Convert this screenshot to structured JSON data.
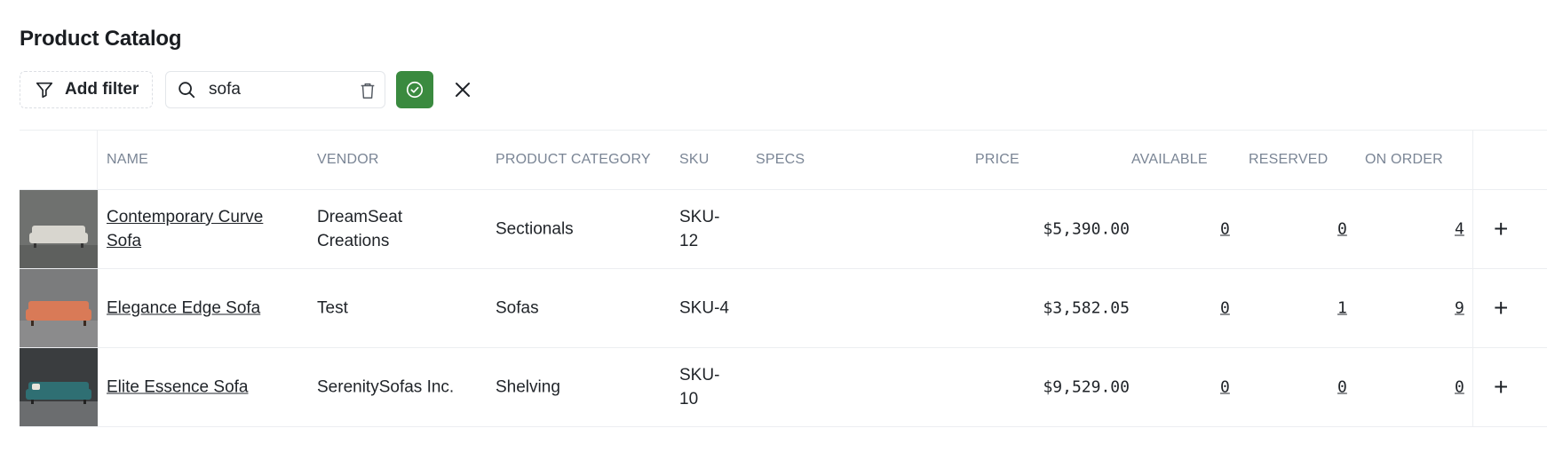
{
  "page": {
    "title": "Product Catalog"
  },
  "toolbar": {
    "add_filter_label": "Add filter",
    "search_value": "sofa",
    "apply_color": "#3a8a3f"
  },
  "table": {
    "headers": {
      "name": "NAME",
      "vendor": "VENDOR",
      "category": "PRODUCT CATEGORY",
      "sku": "SKU",
      "specs": "SPECS",
      "price": "PRICE",
      "available": "AVAILABLE",
      "reserved": "RESERVED",
      "on_order": "ON ORDER"
    },
    "rows": [
      {
        "name": "Contemporary Curve Sofa",
        "vendor": "DreamSeat Creations",
        "category": "Sectionals",
        "sku": "SKU-12",
        "specs": "",
        "price": "$5,390.00",
        "available": "0",
        "reserved": "0",
        "on_order": "4",
        "sofa_color": "#d8d6cf",
        "bg_color": "#6f716f"
      },
      {
        "name": "Elegance Edge Sofa",
        "vendor": "Test",
        "category": "Sofas",
        "sku": "SKU-4",
        "specs": "",
        "price": "$3,582.05",
        "available": "0",
        "reserved": "1",
        "on_order": "9",
        "sofa_color": "#d97a57",
        "bg_color": "#7b7c7d"
      },
      {
        "name": "Elite Essence Sofa",
        "vendor": "SerenitySofas Inc.",
        "category": "Shelving",
        "sku": "SKU-10",
        "specs": "",
        "price": "$9,529.00",
        "available": "0",
        "reserved": "0",
        "on_order": "0",
        "sofa_color": "#2f6f73",
        "bg_color": "#3a3d3f"
      }
    ]
  }
}
